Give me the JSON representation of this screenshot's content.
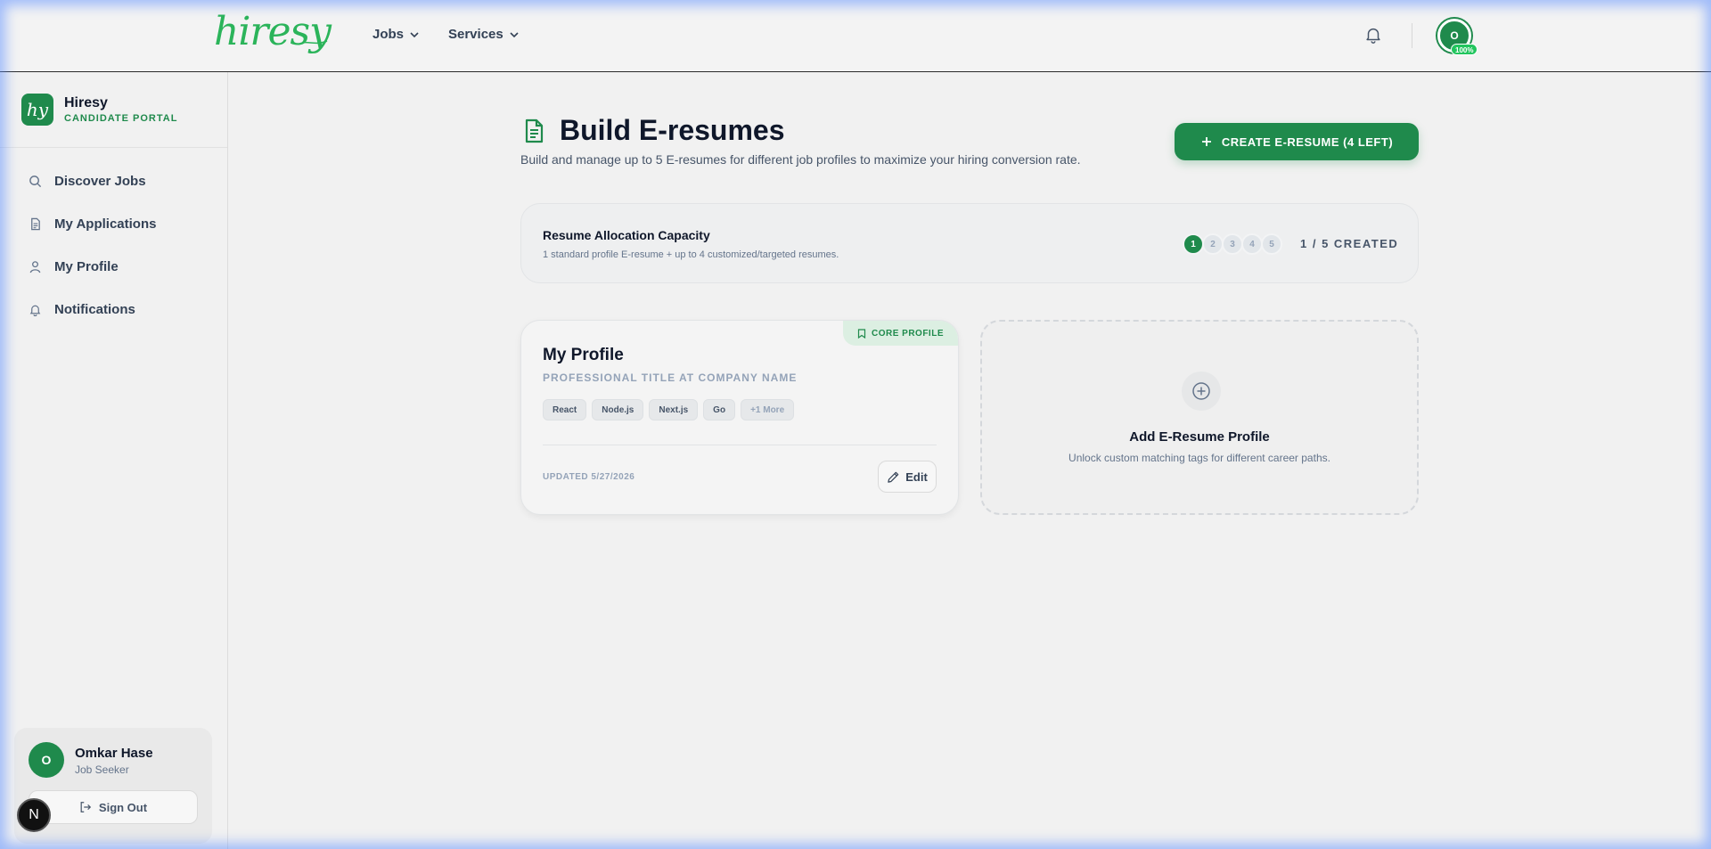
{
  "topbar": {
    "logo_text": "hiresy",
    "nav": [
      {
        "label": "Jobs"
      },
      {
        "label": "Services"
      }
    ],
    "avatar_initial": "O",
    "avatar_badge": "100%"
  },
  "sidebar": {
    "brand_mark": "hy",
    "brand_name": "Hiresy",
    "brand_sub": "CANDIDATE PORTAL",
    "items": [
      {
        "label": "Discover Jobs",
        "icon": "search-icon"
      },
      {
        "label": "My Applications",
        "icon": "document-icon"
      },
      {
        "label": "My Profile",
        "icon": "user-icon"
      },
      {
        "label": "Notifications",
        "icon": "bell-icon"
      }
    ],
    "user": {
      "initial": "O",
      "name": "Omkar Hase",
      "role": "Job Seeker",
      "signout_label": "Sign Out"
    },
    "next_badge": "N"
  },
  "main": {
    "title": "Build E-resumes",
    "subtitle": "Build and manage up to 5 E-resumes for different job profiles to maximize your hiring conversion rate.",
    "create_button": "CREATE E-RESUME (4 LEFT)",
    "capacity": {
      "title": "Resume Allocation Capacity",
      "subtitle": "1 standard profile E-resume + up to 4 customized/targeted resumes.",
      "slots": [
        "1",
        "2",
        "3",
        "4",
        "5"
      ],
      "filled": 1,
      "count_label": "1 / 5 CREATED"
    },
    "profile_card": {
      "badge": "CORE PROFILE",
      "name": "My Profile",
      "title": "PROFESSIONAL TITLE AT COMPANY NAME",
      "tags": [
        "React",
        "Node.js",
        "Next.js",
        "Go"
      ],
      "more_tag": "+1 More",
      "updated": "UPDATED 5/27/2026",
      "edit_label": "Edit"
    },
    "add_card": {
      "title": "Add E-Resume Profile",
      "subtitle": "Unlock custom matching tags for different career paths."
    }
  },
  "colors": {
    "brand_green": "#1f8a4c",
    "logo_green": "#2bb45a",
    "text_dark": "#0f172a",
    "text_muted": "#64748b"
  }
}
